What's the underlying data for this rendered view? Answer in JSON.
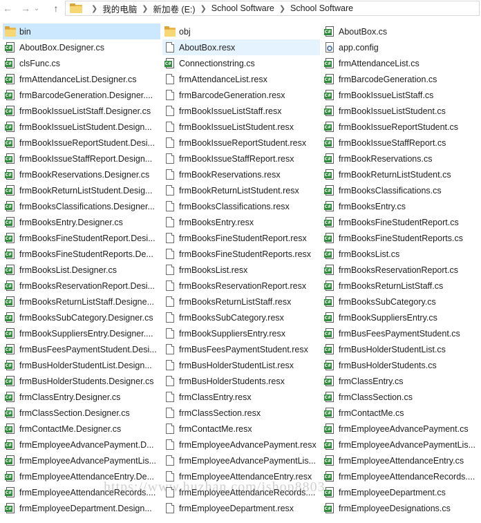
{
  "address": {
    "crumbs": [
      "我的电脑",
      "新加卷 (E:)",
      "School Software",
      "School Software"
    ]
  },
  "icons": {
    "back": "left-arrow-icon",
    "forward": "right-arrow-icon",
    "up": "up-arrow-icon"
  },
  "columns": [
    [
      {
        "name": "bin",
        "type": "folder",
        "selected": true
      },
      {
        "name": "AboutBox.Designer.cs",
        "type": "cs"
      },
      {
        "name": "clsFunc.cs",
        "type": "cs"
      },
      {
        "name": "frmAttendanceList.Designer.cs",
        "type": "cs"
      },
      {
        "name": "frmBarcodeGeneration.Designer....",
        "type": "cs"
      },
      {
        "name": "frmBookIssueListStaff.Designer.cs",
        "type": "cs"
      },
      {
        "name": "frmBookIssueListStudent.Design...",
        "type": "cs"
      },
      {
        "name": "frmBookIssueReportStudent.Desi...",
        "type": "cs"
      },
      {
        "name": "frmBookIssueStaffReport.Design...",
        "type": "cs"
      },
      {
        "name": "frmBookReservations.Designer.cs",
        "type": "cs"
      },
      {
        "name": "frmBookReturnListStudent.Desig...",
        "type": "cs"
      },
      {
        "name": "frmBooksClassifications.Designer...",
        "type": "cs"
      },
      {
        "name": "frmBooksEntry.Designer.cs",
        "type": "cs"
      },
      {
        "name": "frmBooksFineStudentReport.Desi...",
        "type": "cs"
      },
      {
        "name": "frmBooksFineStudentReports.De...",
        "type": "cs"
      },
      {
        "name": "frmBooksList.Designer.cs",
        "type": "cs"
      },
      {
        "name": "frmBooksReservationReport.Desi...",
        "type": "cs"
      },
      {
        "name": "frmBooksReturnListStaff.Designe...",
        "type": "cs"
      },
      {
        "name": "frmBooksSubCategory.Designer.cs",
        "type": "cs"
      },
      {
        "name": "frmBookSuppliersEntry.Designer....",
        "type": "cs"
      },
      {
        "name": "frmBusFeesPaymentStudent.Desi...",
        "type": "cs"
      },
      {
        "name": "frmBusHolderStudentList.Design...",
        "type": "cs"
      },
      {
        "name": "frmBusHolderStudents.Designer.cs",
        "type": "cs"
      },
      {
        "name": "frmClassEntry.Designer.cs",
        "type": "cs"
      },
      {
        "name": "frmClassSection.Designer.cs",
        "type": "cs"
      },
      {
        "name": "frmContactMe.Designer.cs",
        "type": "cs"
      },
      {
        "name": "frmEmployeeAdvancePayment.D...",
        "type": "cs"
      },
      {
        "name": "frmEmployeeAdvancePaymentLis...",
        "type": "cs"
      },
      {
        "name": "frmEmployeeAttendanceEntry.De...",
        "type": "cs"
      },
      {
        "name": "frmEmployeeAttendanceRecords....",
        "type": "cs"
      },
      {
        "name": "frmEmployeeDepartment.Design...",
        "type": "cs"
      }
    ],
    [
      {
        "name": "obj",
        "type": "folder"
      },
      {
        "name": "AboutBox.resx",
        "type": "doc",
        "hover": true
      },
      {
        "name": "Connectionstring.cs",
        "type": "cs"
      },
      {
        "name": "frmAttendanceList.resx",
        "type": "doc"
      },
      {
        "name": "frmBarcodeGeneration.resx",
        "type": "doc"
      },
      {
        "name": "frmBookIssueListStaff.resx",
        "type": "doc"
      },
      {
        "name": "frmBookIssueListStudent.resx",
        "type": "doc"
      },
      {
        "name": "frmBookIssueReportStudent.resx",
        "type": "doc"
      },
      {
        "name": "frmBookIssueStaffReport.resx",
        "type": "doc"
      },
      {
        "name": "frmBookReservations.resx",
        "type": "doc"
      },
      {
        "name": "frmBookReturnListStudent.resx",
        "type": "doc"
      },
      {
        "name": "frmBooksClassifications.resx",
        "type": "doc"
      },
      {
        "name": "frmBooksEntry.resx",
        "type": "doc"
      },
      {
        "name": "frmBooksFineStudentReport.resx",
        "type": "doc"
      },
      {
        "name": "frmBooksFineStudentReports.resx",
        "type": "doc"
      },
      {
        "name": "frmBooksList.resx",
        "type": "doc"
      },
      {
        "name": "frmBooksReservationReport.resx",
        "type": "doc"
      },
      {
        "name": "frmBooksReturnListStaff.resx",
        "type": "doc"
      },
      {
        "name": "frmBooksSubCategory.resx",
        "type": "doc"
      },
      {
        "name": "frmBookSuppliersEntry.resx",
        "type": "doc"
      },
      {
        "name": "frmBusFeesPaymentStudent.resx",
        "type": "doc"
      },
      {
        "name": "frmBusHolderStudentList.resx",
        "type": "doc"
      },
      {
        "name": "frmBusHolderStudents.resx",
        "type": "doc"
      },
      {
        "name": "frmClassEntry.resx",
        "type": "doc"
      },
      {
        "name": "frmClassSection.resx",
        "type": "doc"
      },
      {
        "name": "frmContactMe.resx",
        "type": "doc"
      },
      {
        "name": "frmEmployeeAdvancePayment.resx",
        "type": "doc"
      },
      {
        "name": "frmEmployeeAdvancePaymentLis...",
        "type": "doc"
      },
      {
        "name": "frmEmployeeAttendanceEntry.resx",
        "type": "doc"
      },
      {
        "name": "frmEmployeeAttendanceRecords....",
        "type": "doc"
      },
      {
        "name": "frmEmployeeDepartment.resx",
        "type": "doc"
      }
    ],
    [
      {
        "name": "AboutBox.cs",
        "type": "cs"
      },
      {
        "name": "app.config",
        "type": "cfg"
      },
      {
        "name": "frmAttendanceList.cs",
        "type": "cs"
      },
      {
        "name": "frmBarcodeGeneration.cs",
        "type": "cs"
      },
      {
        "name": "frmBookIssueListStaff.cs",
        "type": "cs"
      },
      {
        "name": "frmBookIssueListStudent.cs",
        "type": "cs"
      },
      {
        "name": "frmBookIssueReportStudent.cs",
        "type": "cs"
      },
      {
        "name": "frmBookIssueStaffReport.cs",
        "type": "cs"
      },
      {
        "name": "frmBookReservations.cs",
        "type": "cs"
      },
      {
        "name": "frmBookReturnListStudent.cs",
        "type": "cs"
      },
      {
        "name": "frmBooksClassifications.cs",
        "type": "cs"
      },
      {
        "name": "frmBooksEntry.cs",
        "type": "cs"
      },
      {
        "name": "frmBooksFineStudentReport.cs",
        "type": "cs"
      },
      {
        "name": "frmBooksFineStudentReports.cs",
        "type": "cs"
      },
      {
        "name": "frmBooksList.cs",
        "type": "cs"
      },
      {
        "name": "frmBooksReservationReport.cs",
        "type": "cs"
      },
      {
        "name": "frmBooksReturnListStaff.cs",
        "type": "cs"
      },
      {
        "name": "frmBooksSubCategory.cs",
        "type": "cs"
      },
      {
        "name": "frmBookSuppliersEntry.cs",
        "type": "cs"
      },
      {
        "name": "frmBusFeesPaymentStudent.cs",
        "type": "cs"
      },
      {
        "name": "frmBusHolderStudentList.cs",
        "type": "cs"
      },
      {
        "name": "frmBusHolderStudents.cs",
        "type": "cs"
      },
      {
        "name": "frmClassEntry.cs",
        "type": "cs"
      },
      {
        "name": "frmClassSection.cs",
        "type": "cs"
      },
      {
        "name": "frmContactMe.cs",
        "type": "cs"
      },
      {
        "name": "frmEmployeeAdvancePayment.cs",
        "type": "cs"
      },
      {
        "name": "frmEmployeeAdvancePaymentLis...",
        "type": "cs"
      },
      {
        "name": "frmEmployeeAttendanceEntry.cs",
        "type": "cs"
      },
      {
        "name": "frmEmployeeAttendanceRecords....",
        "type": "cs"
      },
      {
        "name": "frmEmployeeDepartment.cs",
        "type": "cs"
      },
      {
        "name": "frmEmployeeDesignations.cs",
        "type": "cs"
      }
    ]
  ],
  "watermark": "https://www.huzhan.com/ishop8803",
  "colors": {
    "selection": "#cce8ff",
    "hover": "#e5f3ff",
    "folder": "#f7d774",
    "cs_badge": "#2f8a3c"
  }
}
